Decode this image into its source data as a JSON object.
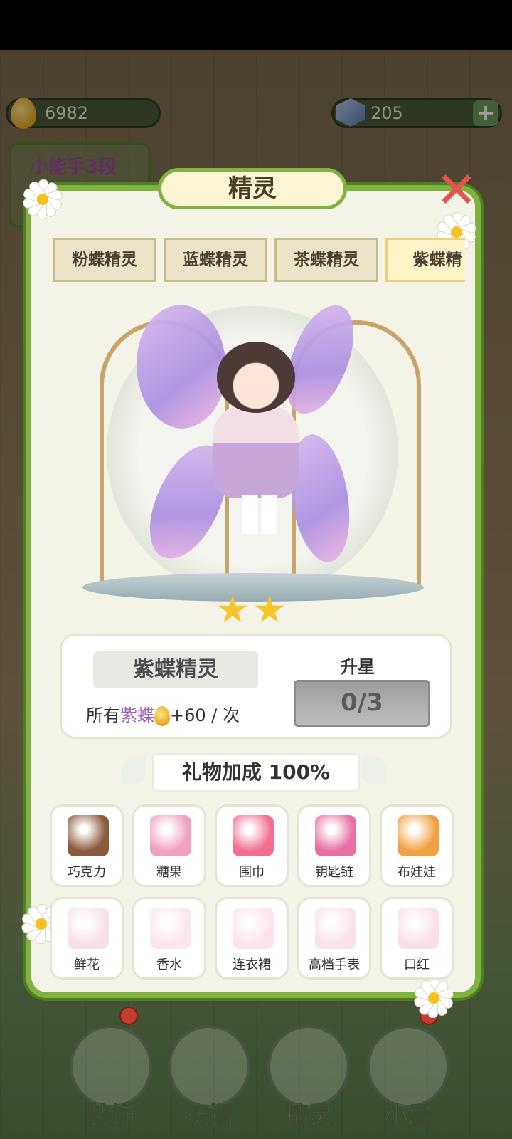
{
  "resources": {
    "coins": "6982",
    "gems": "205"
  },
  "level_badge": "小能手3段",
  "panel": {
    "title": "精灵"
  },
  "tabs": [
    "粉蝶精灵",
    "蓝蝶精灵",
    "茶蝶精灵",
    "紫蝶精"
  ],
  "active_tab": 3,
  "fairy": {
    "name": "紫蝶精灵",
    "stars": 2,
    "bonus_prefix": "所有",
    "bonus_target": "紫蝶",
    "bonus_value": "+60",
    "bonus_suffix": "/ 次",
    "upgrade_label": "升星",
    "upgrade_progress": "0/3"
  },
  "gift_bonus": "礼物加成 100%",
  "gifts": [
    {
      "label": "巧克力",
      "unlocked": true,
      "icon": "chocolate-icon",
      "color": "#8a5a3c"
    },
    {
      "label": "糖果",
      "unlocked": true,
      "icon": "candy-jar-icon",
      "color": "#f2a0c0"
    },
    {
      "label": "围巾",
      "unlocked": true,
      "icon": "scarf-icon",
      "color": "#f26f8f"
    },
    {
      "label": "钥匙链",
      "unlocked": true,
      "icon": "keychain-icon",
      "color": "#e86fa0"
    },
    {
      "label": "布娃娃",
      "unlocked": true,
      "icon": "doll-icon",
      "color": "#f0a040"
    },
    {
      "label": "鲜花",
      "unlocked": false,
      "icon": "bouquet-icon",
      "color": "#e7a8c8"
    },
    {
      "label": "香水",
      "unlocked": false,
      "icon": "perfume-icon",
      "color": "#f0b8c8"
    },
    {
      "label": "连衣裙",
      "unlocked": false,
      "icon": "dress-icon",
      "color": "#f4b0c8"
    },
    {
      "label": "高档手表",
      "unlocked": false,
      "icon": "watch-icon",
      "color": "#e8b0c0"
    },
    {
      "label": "口红",
      "unlocked": false,
      "icon": "lipstick-icon",
      "color": "#f0a8b8"
    }
  ],
  "bottom_nav": [
    "装饰",
    "祝福",
    "精灵",
    "小屋"
  ],
  "colors": {
    "vine_green": "#7fb23f",
    "panel_bg": "#f4f3e8",
    "close_red": "#e2554b",
    "star_gold": "#f5c52a"
  }
}
